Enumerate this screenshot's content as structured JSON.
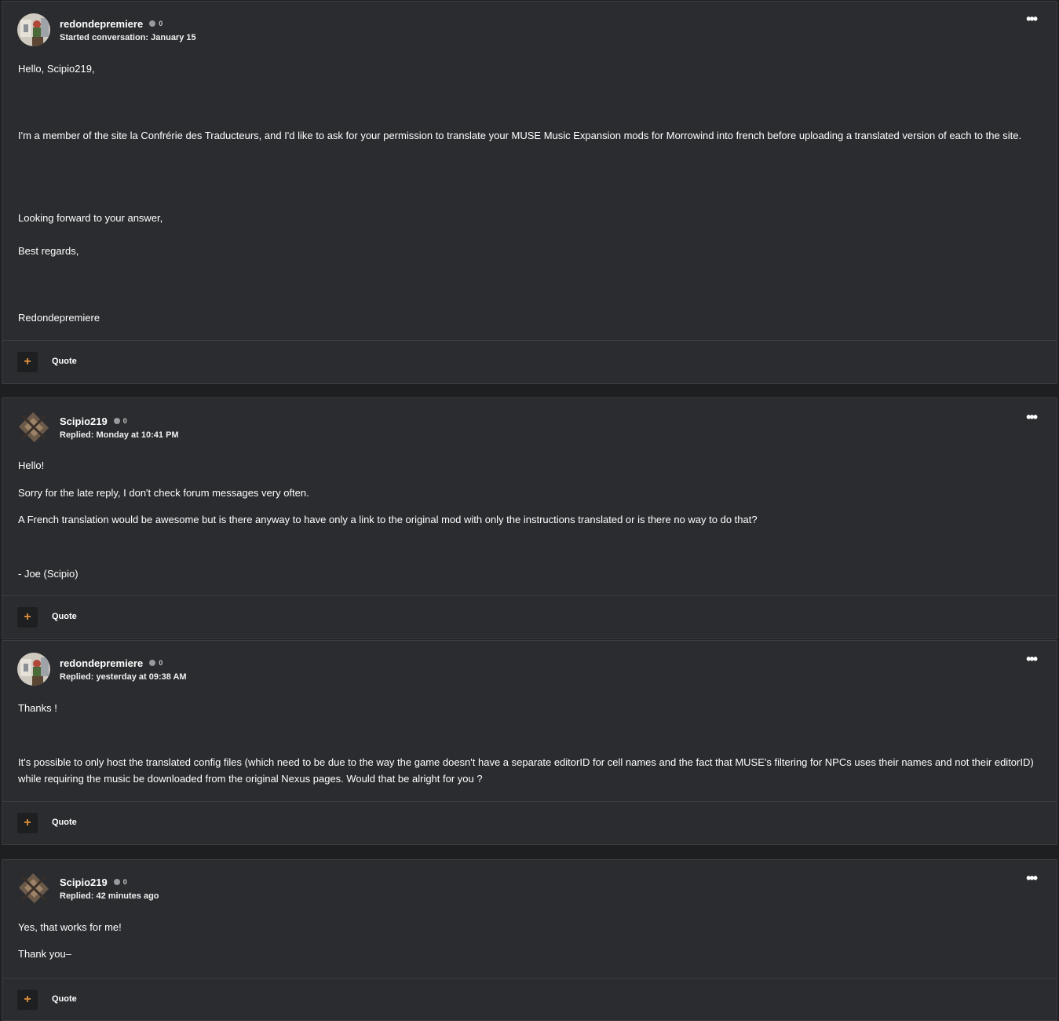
{
  "posts": [
    {
      "author": "redondepremiere",
      "reputation": "0",
      "meta": "Started conversation: January 15",
      "paragraphs": [
        "Hello, Scipio219,",
        "I'm a member of the site la Confrérie des Traducteurs, and I'd like to ask for your permission to translate your MUSE Music Expansion mods for Morrowind into french before uploading a translated version of each to the site.",
        "Looking forward to your answer,",
        "Best regards,",
        "Redondepremiere"
      ],
      "more_icon": "ellipsis-icon",
      "plus_label": "+",
      "quote_label": "Quote"
    },
    {
      "author": "Scipio219",
      "reputation": "0",
      "meta": "Replied: Monday at 10:41 PM",
      "paragraphs": [
        "Hello!",
        "Sorry for the late reply, I don't check forum messages very often.",
        "A French translation would be awesome but is there anyway to have only a link to the original mod with only the instructions translated or is there no way to do that?",
        "- Joe (Scipio)"
      ],
      "more_icon": "ellipsis-icon",
      "plus_label": "+",
      "quote_label": "Quote"
    },
    {
      "author": "redondepremiere",
      "reputation": "0",
      "meta": "Replied: yesterday at 09:38 AM",
      "paragraphs": [
        "Thanks !",
        "It's possible to only host the translated config files (which need to be due to the way the game doesn't have a separate editorID for cell names and the fact that MUSE's filtering for NPCs uses their names and not their editorID) while requiring the music be downloaded from the original Nexus pages. Would that be alright for you ?"
      ],
      "more_icon": "ellipsis-icon",
      "plus_label": "+",
      "quote_label": "Quote"
    },
    {
      "author": "Scipio219",
      "reputation": "0",
      "meta": "Replied: 42 minutes ago",
      "paragraphs": [
        "Yes, that works for me!",
        "Thank you–"
      ],
      "more_icon": "ellipsis-icon",
      "plus_label": "+",
      "quote_label": "Quote"
    }
  ],
  "colors": {
    "page_background": "#1e1f21",
    "post_background": "#2b2c2f",
    "border": "#3c3d41",
    "accent_plus": "#e0913b",
    "text": "#ffffff"
  }
}
